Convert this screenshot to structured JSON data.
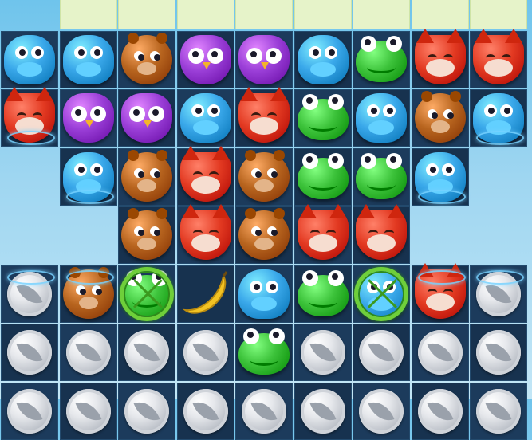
{
  "board": {
    "columns": 9,
    "rows": [
      [
        "hidden",
        "top",
        "top",
        "top",
        "top",
        "top",
        "top",
        "top",
        "top"
      ],
      [
        "hippo",
        "hippo",
        "bear",
        "owl",
        "owl",
        "hippo",
        "frog",
        "fox",
        "fox"
      ],
      [
        "fox",
        "owl",
        "owl",
        "hippo",
        "fox",
        "frog",
        "hippo",
        "bear",
        "hippo"
      ],
      [
        null,
        "hippo",
        "bear",
        "fox",
        "bear",
        "frog",
        "frog",
        "hippo",
        null
      ],
      [
        null,
        null,
        "bear",
        "fox",
        "bear",
        "fox",
        "fox",
        null,
        null
      ],
      [
        "coin",
        "bear",
        "vine-frog",
        "banana",
        "hippo",
        "frog",
        "vine-hippo",
        "fox",
        "coin"
      ],
      [
        "coin",
        "coin",
        "coin",
        "coin",
        "frog",
        "coin",
        "coin",
        "coin",
        "coin"
      ],
      [
        "coin",
        "coin",
        "coin",
        "coin",
        "coin",
        "coin",
        "coin",
        "coin",
        "coin"
      ]
    ],
    "portals_bottom": [
      [
        2,
        0
      ],
      [
        3,
        1
      ],
      [
        3,
        7
      ],
      [
        2,
        8
      ]
    ],
    "portals_top": [
      [
        5,
        0
      ],
      [
        5,
        1
      ],
      [
        5,
        7
      ],
      [
        5,
        8
      ]
    ]
  },
  "piece_icons": {
    "hippo": "blue-hippo-icon",
    "bear": "brown-bear-icon",
    "owl": "purple-owl-icon",
    "frog": "green-frog-icon",
    "fox": "red-fox-icon",
    "banana": "yellow-banana-icon",
    "coin": "silver-leaf-coin-icon"
  },
  "colors": {
    "hippo": "#3aa8ea",
    "bear": "#b8651f",
    "owl": "#9b3fd8",
    "frog": "#3cc23a",
    "fox": "#e33a22",
    "banana": "#f3c323",
    "sky": "#8fd0ef",
    "board": "#17324f"
  }
}
